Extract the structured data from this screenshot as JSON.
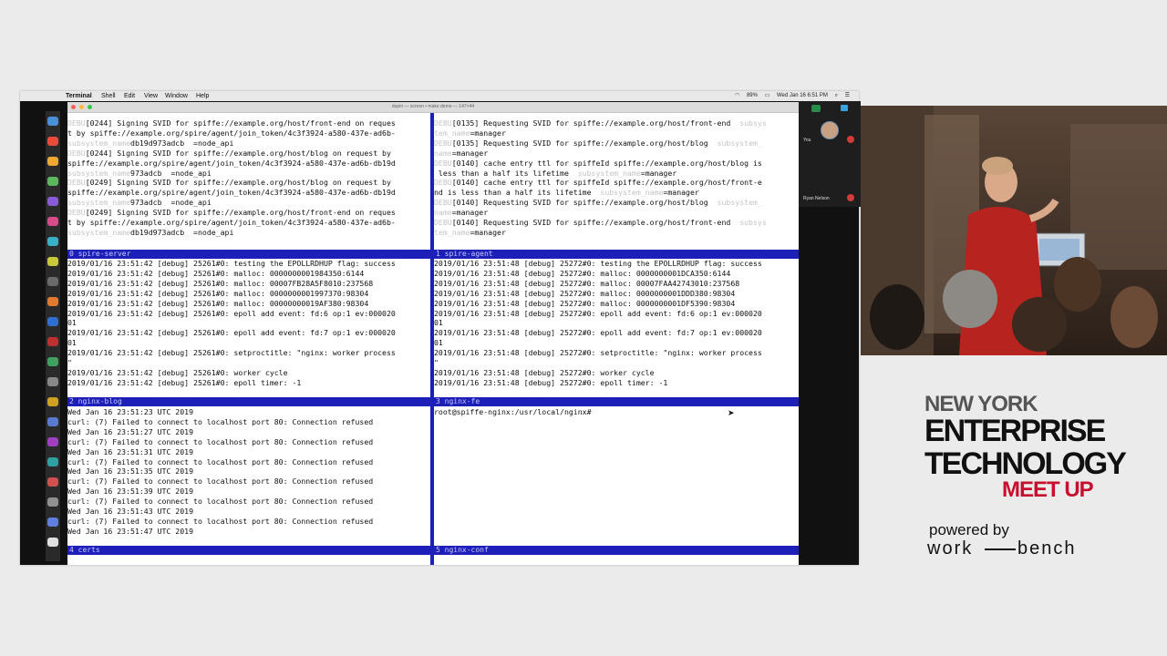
{
  "menubar": {
    "apple": "",
    "items": [
      "Terminal",
      "Shell",
      "Edit",
      "View",
      "Window",
      "Help"
    ],
    "battery": "89%",
    "clock": "Wed Jan 16  6:51 PM"
  },
  "window": {
    "title": "dupin — screen • make demo — 147×44"
  },
  "panes": [
    {
      "status": "0 spire-server",
      "lines": [
        {
          "d": "DEBU",
          "t": "[0244] Signing SVID for spiffe://example.org/host/front-end on reques"
        },
        {
          "t": "t by spiffe://example.org/spire/agent/join_token/4c3f3924-a580-437e-ad6b-"
        },
        {
          "t": "db19d973adcb  ",
          "d": "subsystem_name",
          "t2": "=node_api"
        },
        {
          "d": "DEBU",
          "t": "[0244] Signing SVID for spiffe://example.org/host/blog on request by"
        },
        {
          "t": "spiffe://example.org/spire/agent/join_token/4c3f3924-a580-437e-ad6b-db19d"
        },
        {
          "t": "973adcb  ",
          "d": "subsystem_name",
          "t2": "=node_api"
        },
        {
          "d": "DEBU",
          "t": "[0249] Signing SVID for spiffe://example.org/host/blog on request by"
        },
        {
          "t": "spiffe://example.org/spire/agent/join_token/4c3f3924-a580-437e-ad6b-db19d"
        },
        {
          "t": "973adcb  ",
          "d": "subsystem_name",
          "t2": "=node_api"
        },
        {
          "d": "DEBU",
          "t": "[0249] Signing SVID for spiffe://example.org/host/front-end on reques"
        },
        {
          "t": "t by spiffe://example.org/spire/agent/join_token/4c3f3924-a580-437e-ad6b-"
        },
        {
          "t": "db19d973adcb  ",
          "d": "subsystem_name",
          "t2": "=node_api"
        }
      ]
    },
    {
      "status": "1 spire-agent",
      "lines": [
        {
          "d": "DEBU",
          "t": "[0135] Requesting SVID for spiffe://example.org/host/front-end  ",
          "d2": "subsys"
        },
        {
          "d": "tem_name",
          "t": "=manager"
        },
        {
          "d": "DEBU",
          "t": "[0135] Requesting SVID for spiffe://example.org/host/blog  ",
          "d2": "subsystem_"
        },
        {
          "d": "name",
          "t": "=manager"
        },
        {
          "d": "DEBU",
          "t": "[0140] cache entry ttl for spiffeId spiffe://example.org/host/blog is"
        },
        {
          "t": " less than a half its lifetime  ",
          "d2": "subsystem_name",
          "t2": "=manager"
        },
        {
          "d": "DEBU",
          "t": "[0140] cache entry ttl for spiffeId spiffe://example.org/host/front-e"
        },
        {
          "t": "nd is less than a half its lifetime  ",
          "d2": "subsystem_name",
          "t2": "=manager"
        },
        {
          "d": "DEBU",
          "t": "[0140] Requesting SVID for spiffe://example.org/host/blog  ",
          "d2": "subsystem_"
        },
        {
          "d": "name",
          "t": "=manager"
        },
        {
          "d": "DEBU",
          "t": "[0140] Requesting SVID for spiffe://example.org/host/front-end  ",
          "d2": "subsys"
        },
        {
          "d": "tem_name",
          "t": "=manager"
        }
      ]
    },
    {
      "status": "",
      "lines": [
        {
          "t": "2019/01/16 23:51:42 [debug] 25261#0: testing the EPOLLRDHUP flag: success"
        },
        {
          "t": "2019/01/16 23:51:42 [debug] 25261#0: malloc: 0000000001984350:6144"
        },
        {
          "t": "2019/01/16 23:51:42 [debug] 25261#0: malloc: 00007FB28A5F8010:237568"
        },
        {
          "t": "2019/01/16 23:51:42 [debug] 25261#0: malloc: 0000000001997370:98304"
        },
        {
          "t": "2019/01/16 23:51:42 [debug] 25261#0: malloc: 00000000019AF380:98304"
        },
        {
          "t": "2019/01/16 23:51:42 [debug] 25261#0: epoll add event: fd:6 op:1 ev:000020"
        },
        {
          "t": "01"
        },
        {
          "t": "2019/01/16 23:51:42 [debug] 25261#0: epoll add event: fd:7 op:1 ev:000020"
        },
        {
          "t": "01"
        },
        {
          "t": "2019/01/16 23:51:42 [debug] 25261#0: setproctitle: \"nginx: worker process"
        },
        {
          "t": "\""
        },
        {
          "t": "2019/01/16 23:51:42 [debug] 25261#0: worker cycle"
        },
        {
          "t": "2019/01/16 23:51:42 [debug] 25261#0: epoll timer: -1"
        }
      ]
    },
    {
      "status": "",
      "lines": [
        {
          "t": "2019/01/16 23:51:48 [debug] 25272#0: testing the EPOLLRDHUP flag: success"
        },
        {
          "t": "2019/01/16 23:51:48 [debug] 25272#0: malloc: 0000000001DCA350:6144"
        },
        {
          "t": "2019/01/16 23:51:48 [debug] 25272#0: malloc: 00007FAA42743010:237568"
        },
        {
          "t": "2019/01/16 23:51:48 [debug] 25272#0: malloc: 0000000001DDD380:98304"
        },
        {
          "t": "2019/01/16 23:51:48 [debug] 25272#0: malloc: 0000000001DF5390:98304"
        },
        {
          "t": "2019/01/16 23:51:48 [debug] 25272#0: epoll add event: fd:6 op:1 ev:000020"
        },
        {
          "t": "01"
        },
        {
          "t": "2019/01/16 23:51:48 [debug] 25272#0: epoll add event: fd:7 op:1 ev:000020"
        },
        {
          "t": "01"
        },
        {
          "t": "2019/01/16 23:51:48 [debug] 25272#0: setproctitle: \"nginx: worker process"
        },
        {
          "t": "\""
        },
        {
          "t": "2019/01/16 23:51:48 [debug] 25272#0: worker cycle"
        },
        {
          "t": "2019/01/16 23:51:48 [debug] 25272#0: epoll timer: -1"
        }
      ]
    },
    {
      "status": "2 nginx-blog",
      "lines": [
        {
          "t": "Wed Jan 16 23:51:23 UTC 2019"
        },
        {
          "t": "curl: (7) Failed to connect to localhost port 80: Connection refused"
        },
        {
          "t": "Wed Jan 16 23:51:27 UTC 2019"
        },
        {
          "t": "curl: (7) Failed to connect to localhost port 80: Connection refused"
        },
        {
          "t": "Wed Jan 16 23:51:31 UTC 2019"
        },
        {
          "t": "curl: (7) Failed to connect to localhost port 80: Connection refused"
        },
        {
          "t": "Wed Jan 16 23:51:35 UTC 2019"
        },
        {
          "t": "curl: (7) Failed to connect to localhost port 80: Connection refused"
        },
        {
          "t": "Wed Jan 16 23:51:39 UTC 2019"
        },
        {
          "t": "curl: (7) Failed to connect to localhost port 80: Connection refused"
        },
        {
          "t": "Wed Jan 16 23:51:43 UTC 2019"
        },
        {
          "t": "curl: (7) Failed to connect to localhost port 80: Connection refused"
        },
        {
          "t": "Wed Jan 16 23:51:47 UTC 2019"
        }
      ]
    },
    {
      "status": "3 nginx-fe",
      "lines": [
        {
          "t": "root@spiffe-nginx:/usr/local/nginx#"
        }
      ]
    }
  ],
  "bottom_status": {
    "left": "4 certs",
    "right": "5 nginx-conf"
  },
  "meeting": {
    "you_label": "You",
    "participant_name": "Ryan Nelson"
  },
  "branding": {
    "line1": "NEW YORK",
    "line2": "ENTERPRISE",
    "line3": "TECHNOLOGY",
    "line4": "MEET UP",
    "powered_by": "powered by",
    "workbench_left": "work",
    "workbench_right": "bench"
  },
  "colors": {
    "tmux_status": "#1d20b8",
    "meetup_red": "#c8102e"
  }
}
